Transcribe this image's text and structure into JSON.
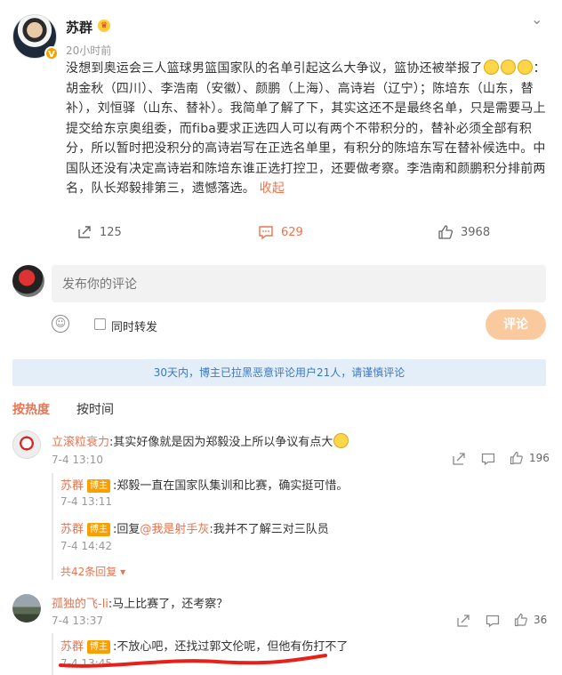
{
  "post": {
    "author": "苏群",
    "time": "20小时前",
    "text_1": "没想到奥运会三人篮球男篮国家队的名单引起这么大争议，篮协还被举报了",
    "text_2": "：胡金秋（四川）、李浩南（安徽）、颜鹏（上海）、高诗岩（辽宁）；陈培东（山东，替补），刘恒驿（山东、替补）。我简单了解了下，其实这还不是最终名单，只是需要马上提交给东京奥组委，而fiba要求正选四人可以有两个不带积分的，替补必须全部有积分，所以暂时把没积分的高诗岩写在正选名单里，有积分的陈培东写在替补候选中。中国队还没有决定高诗岩和陈培东谁正选打控卫，还要做考察。李浩南和颜鹏积分排前两名，队长郑毅排第三，遗憾落选。",
    "collapse": "收起"
  },
  "actions": {
    "forward": "125",
    "comment": "629",
    "like": "3968"
  },
  "composer": {
    "placeholder": "发布你的评论",
    "repost_label": "同时转发",
    "submit": "评论"
  },
  "notice": "30天内，博主已拉黑恶意评论用户21人，请谨慎评论",
  "sort": {
    "hot": "按热度",
    "time": "按时间"
  },
  "comments": [
    {
      "user": "立滚粒衰力",
      "text": ":其实好像就是因为郑毅没上所以争议有点大",
      "time": "7-4 13:10",
      "likes": "196",
      "replies": [
        {
          "user": "苏群",
          "tag": "博主",
          "text": ":郑毅一直在国家队集训和比赛，确实挺可惜。",
          "time": "7-4 13:11"
        },
        {
          "user": "苏群",
          "tag": "博主",
          "text_pre": ":回复",
          "mention": "@我是射手灰",
          "text": ":我并不了解三对三队员",
          "time": "7-4 14:42"
        }
      ],
      "more": "共42条回复"
    },
    {
      "user": "孤独的飞-li",
      "text": ":马上比赛了，还考察？",
      "time": "7-4 13:37",
      "likes": "36",
      "replies": [
        {
          "user": "苏群",
          "tag": "博主",
          "text": ":不放心吧，还找过郭文伦呢，但他有伤打不了",
          "time": "7-4 13:45"
        }
      ]
    }
  ],
  "colors": {
    "accent": "#eb7350",
    "tag": "#f7a000",
    "notice_bg": "#e4eef8",
    "notice_text": "#3a78c2",
    "underline": "#e8201a"
  },
  "icons": [
    "chevron-down-icon",
    "forward-icon",
    "comment-icon",
    "like-icon",
    "smile-icon",
    "share-icon",
    "comment-icon",
    "like-icon"
  ]
}
